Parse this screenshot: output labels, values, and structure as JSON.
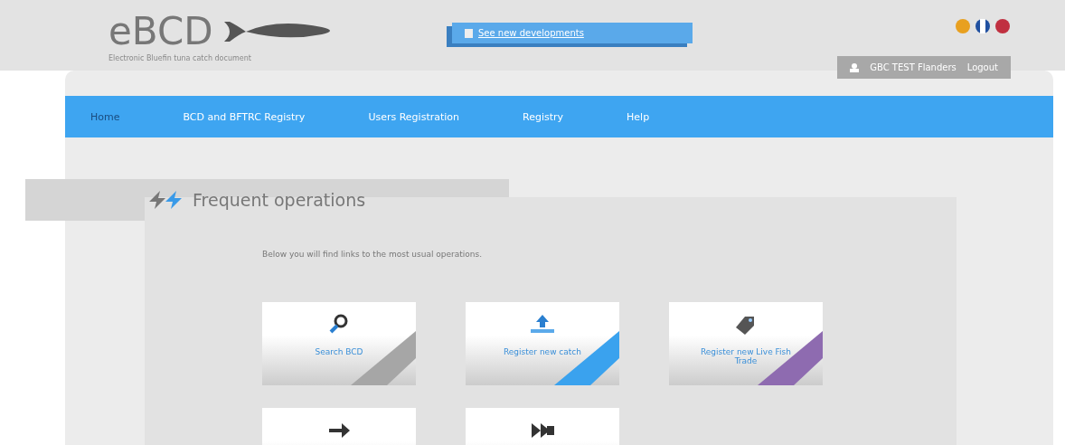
{
  "header": {
    "logo": "eBCD",
    "tagline": "Electronic Bluefin tuna catch document",
    "news_link": "See new developments",
    "user": "GBC TEST Flanders",
    "logout": "Logout"
  },
  "nav": [
    {
      "label": "Home",
      "selected": true
    },
    {
      "label": "BCD and BFTRC Registry",
      "selected": false
    },
    {
      "label": "Users Registration",
      "selected": false
    },
    {
      "label": "Registry",
      "selected": false
    },
    {
      "label": "Help",
      "selected": false
    }
  ],
  "section": {
    "title": "Frequent operations",
    "intro": "Below you will find links to the most usual operations."
  },
  "tiles": [
    {
      "kind": "search",
      "label": "Search BCD",
      "color": "#a6a6a6"
    },
    {
      "kind": "upload",
      "label": "Register new catch",
      "color": "#3aa2ee"
    },
    {
      "kind": "tag",
      "label": "Register new Live Fish Trade",
      "color": "#8e6bb0"
    },
    {
      "kind": "arrow"
    },
    {
      "kind": "double-arrow"
    }
  ]
}
